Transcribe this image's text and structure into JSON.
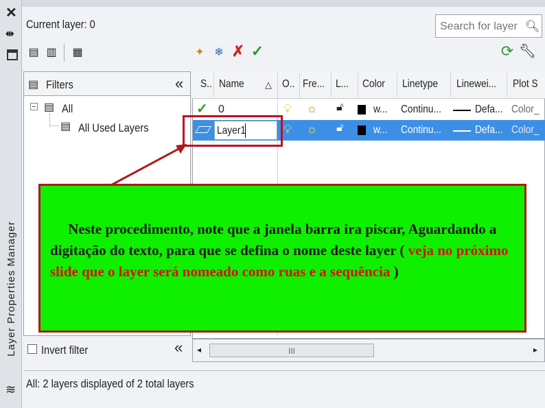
{
  "palette": {
    "title": "Layer Properties Manager",
    "current_layer": "Current layer: 0",
    "search_placeholder": "Search for layer"
  },
  "filters": {
    "header": "Filters",
    "tree": [
      {
        "label": "All",
        "icon": "layer-filter-icon"
      },
      {
        "label": "All Used Layers",
        "icon": "layer-filter-icon"
      }
    ],
    "invert_filter": "Invert filter",
    "invert_checked": false
  },
  "grid": {
    "columns": [
      "S..",
      "Name",
      "O..",
      "Fre...",
      "L...",
      "Color",
      "Linetype",
      "Linewei...",
      "Plot S"
    ],
    "rows": [
      {
        "status": "current-check-icon",
        "name": "0",
        "on": "lightbulb-on",
        "freeze": "sun-icon",
        "lock": "unlocked-icon",
        "color_swatch": "#000000",
        "color": "w...",
        "linetype": "Continu...",
        "lineweight": "Defa...",
        "plot_style": "Color_"
      },
      {
        "status": "new-layer-icon",
        "name": "Layer1",
        "on": "lightbulb-on",
        "freeze": "sun-icon",
        "lock": "unlocked-icon",
        "color_swatch": "#000000",
        "color": "w...",
        "linetype": "Continu...",
        "lineweight": "Defa...",
        "plot_style": "Color_",
        "selected": true
      }
    ]
  },
  "callout": {
    "text_black_1": "Neste procedimento, note que a janela barra ira piscar, Aguardando a digitação do texto, para que se defina o nome deste layer ( ",
    "text_red": "veja no próximo slide que o layer será nomeado como ruas e a sequência",
    "text_black_2": " )",
    "colors": {
      "background": "#00f000",
      "border": "#b01818",
      "emphasis": "#d81010"
    }
  },
  "status_bar": {
    "text": "All: 2 layers displayed of 2 total layers"
  },
  "scrollbar": {
    "thumb_label": "III"
  },
  "colors": {
    "selection": "#3d8fe6",
    "highlight_box": "#c0101f"
  }
}
